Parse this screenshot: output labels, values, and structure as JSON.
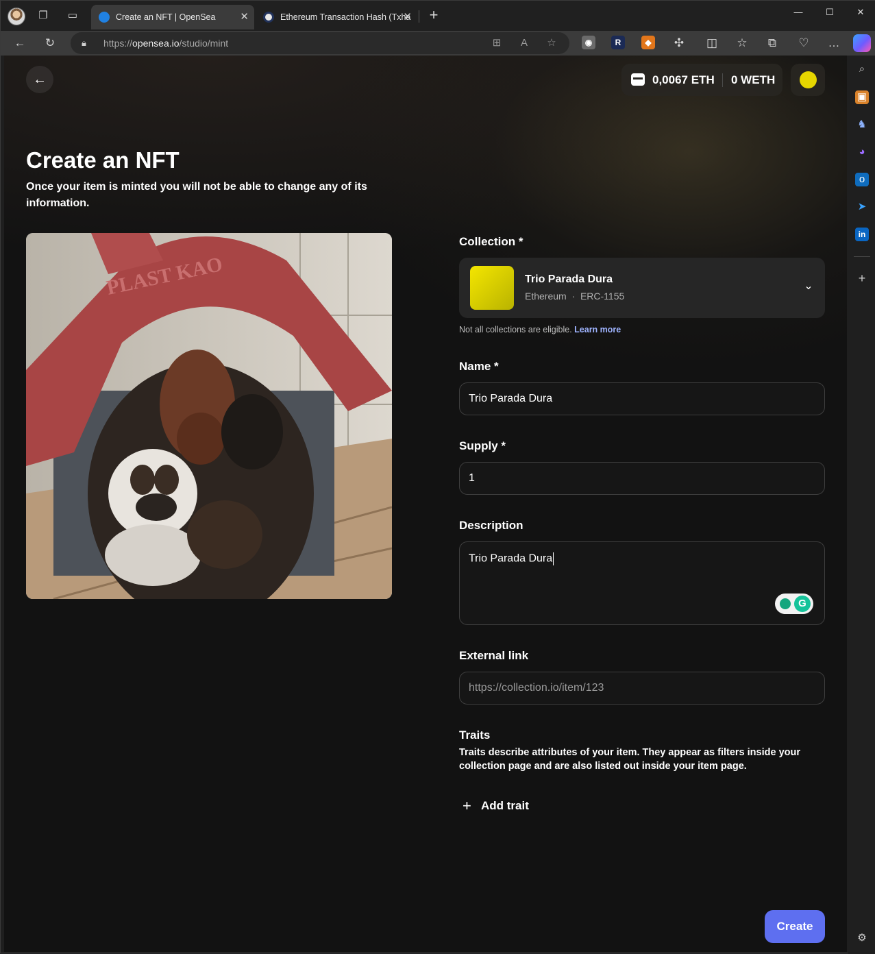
{
  "browser": {
    "tabs": [
      {
        "title": "Create an NFT | OpenSea",
        "active": true
      },
      {
        "title": "Ethereum Transaction Hash (Txha",
        "active": false
      }
    ],
    "url_prefix": "https://",
    "url_host": "opensea.io",
    "url_path": "/studio/mint",
    "window_buttons": {
      "minimize": "—",
      "maximize": "☐",
      "close": "✕"
    }
  },
  "header": {
    "eth_balance": "0,0067 ETH",
    "weth_balance": "0 WETH",
    "avatar_color": "#e6d600"
  },
  "page": {
    "title": "Create an NFT",
    "subtitle": "Once your item is minted you will not be able to change any of its information."
  },
  "form": {
    "collection_label": "Collection *",
    "collection": {
      "name": "Trio Parada Dura",
      "chain": "Ethereum",
      "separator": "·",
      "standard": "ERC-1155"
    },
    "collection_hint": "Not all collections are eligible.",
    "collection_hint_link": "Learn more",
    "name_label": "Name *",
    "name_value": "Trio Parada Dura",
    "supply_label": "Supply *",
    "supply_value": "1",
    "description_label": "Description",
    "description_value": "Trio Parada Dura",
    "external_link_label": "External link",
    "external_link_placeholder": "https://collection.io/item/123",
    "traits_label": "Traits",
    "traits_description": "Traits describe attributes of your item. They appear as filters inside your collection page and are also listed out inside your item page.",
    "add_trait_label": "Add trait",
    "create_label": "Create"
  },
  "colors": {
    "accent": "#5e6ff0",
    "page_background": "#121212",
    "collection_thumb": "#f4e600"
  },
  "icons": [
    "back-arrow-icon",
    "refresh-icon",
    "lock-icon",
    "wallet-icon",
    "chevron-down-icon",
    "plus-icon",
    "grammarly-icon"
  ]
}
